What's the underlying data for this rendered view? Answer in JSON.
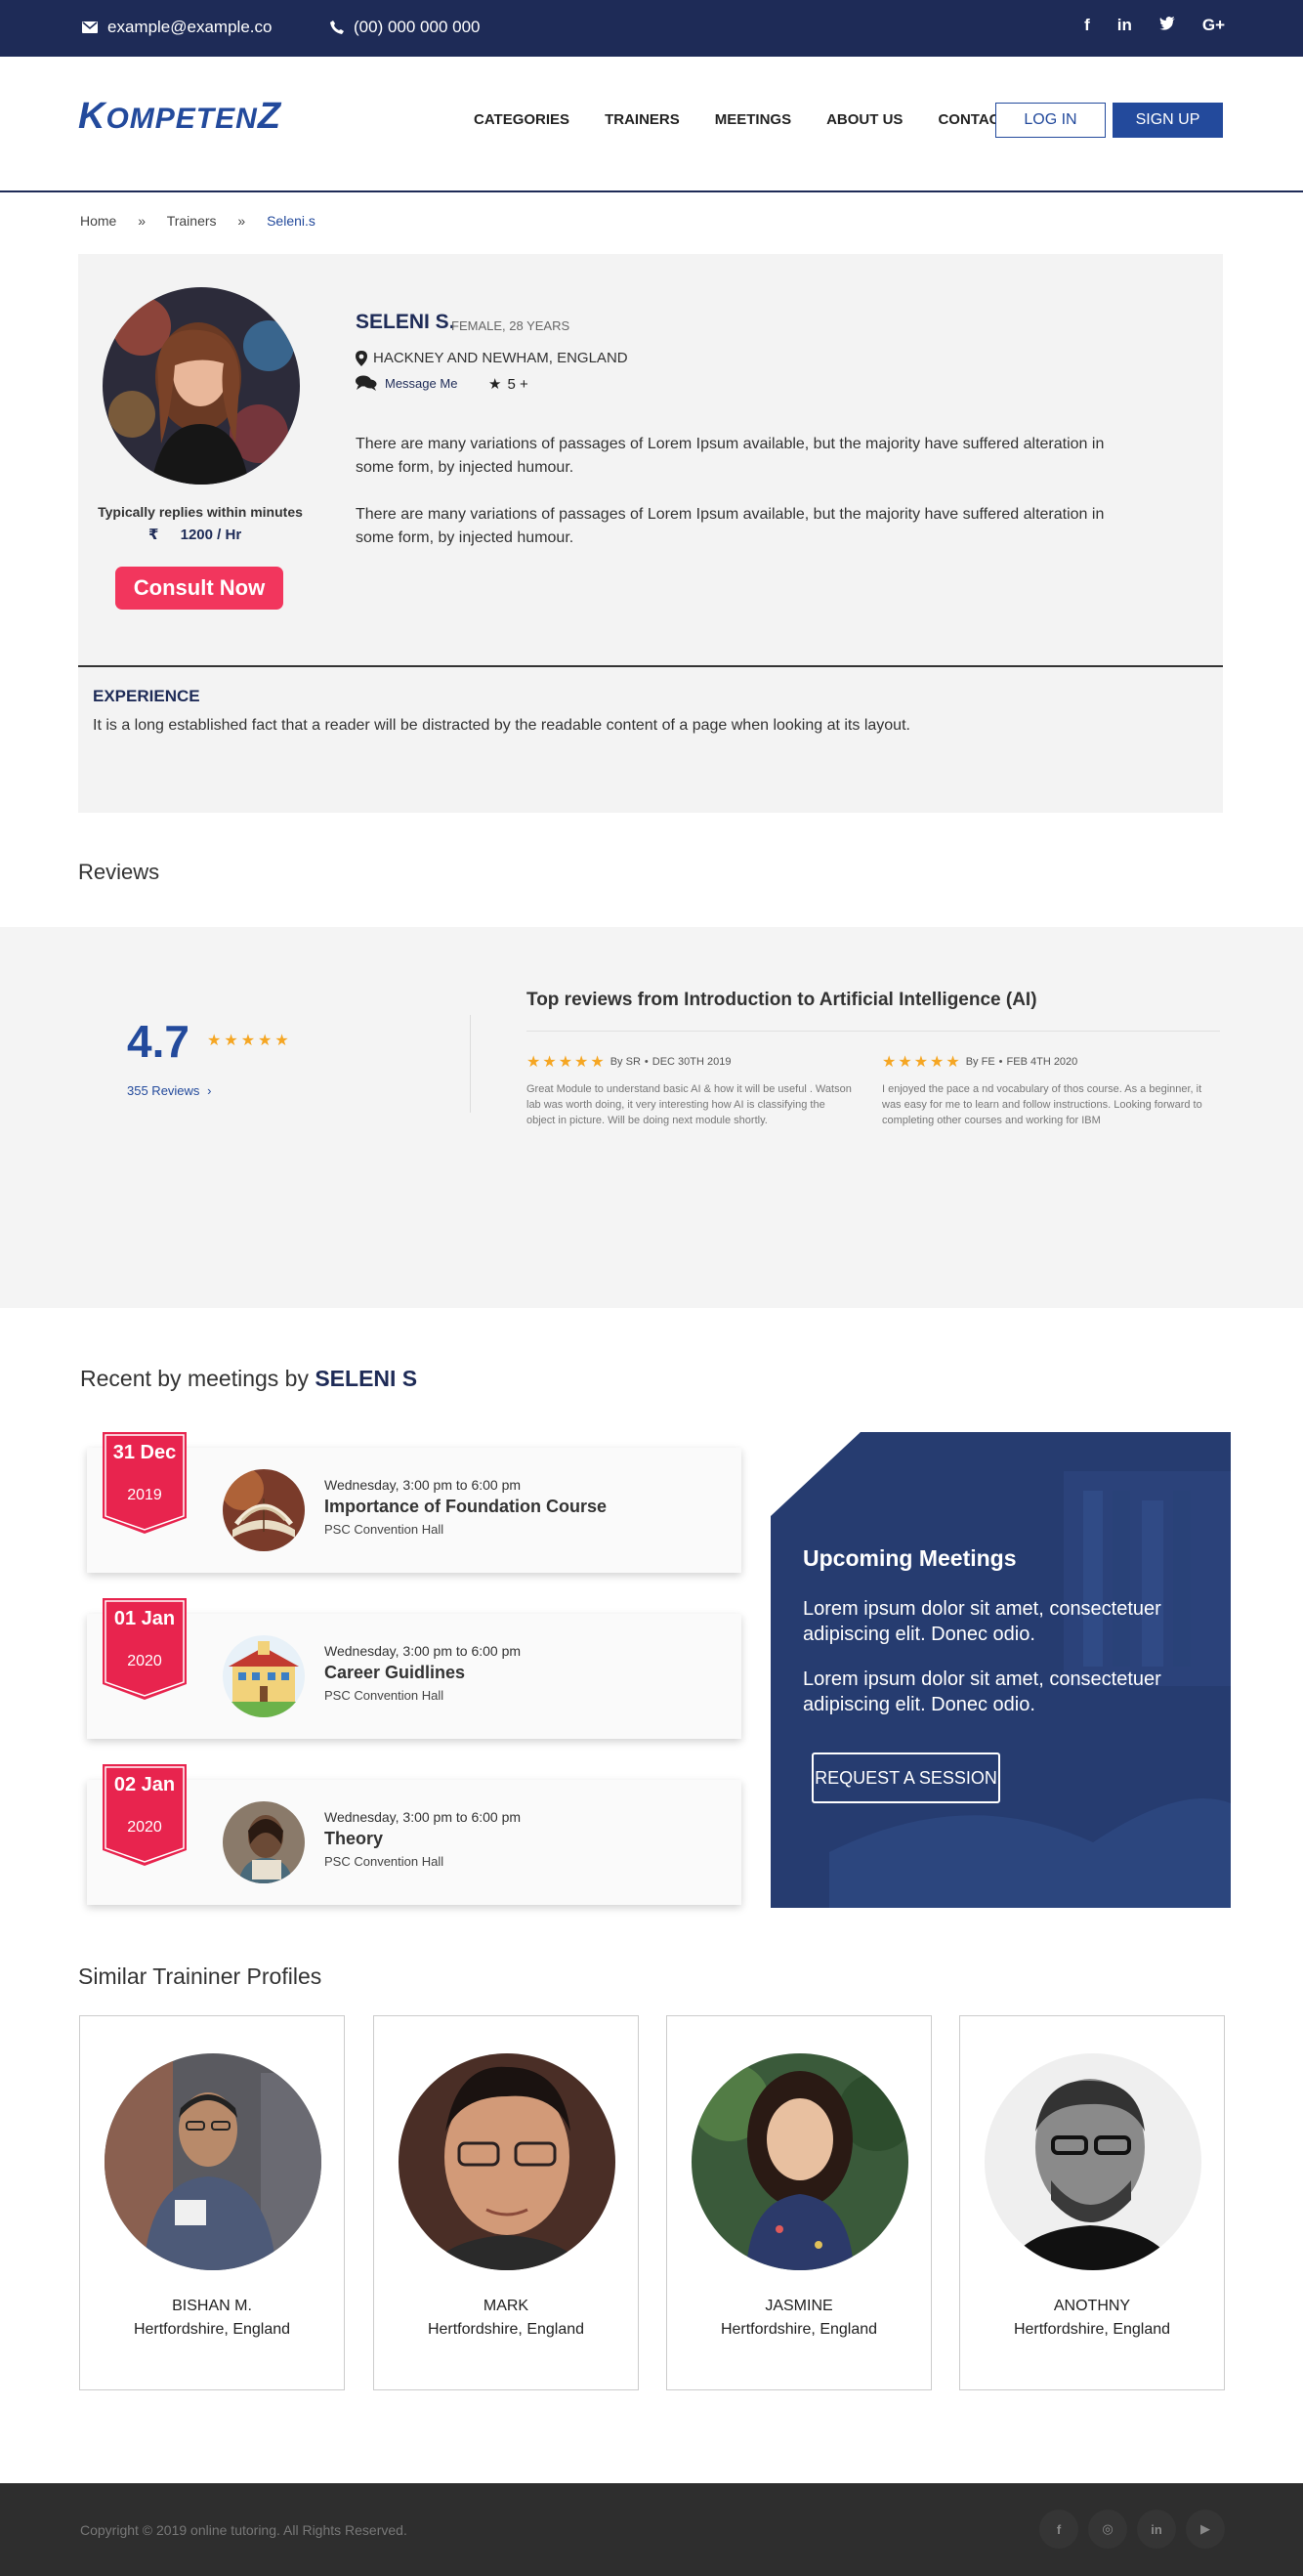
{
  "topbar": {
    "email": "example@example.co",
    "phone": "(00) 000 000 000",
    "social": [
      "f",
      "in",
      "t",
      "G+"
    ]
  },
  "header": {
    "logo_first": "K",
    "logo_rest": "OMPETEN",
    "logo_last": "Z",
    "nav": [
      "CATEGORIES",
      "TRAINERS",
      "MEETINGS",
      "ABOUT US",
      "CONTACT"
    ],
    "login": "LOG IN",
    "signup": "SIGN UP"
  },
  "breadcrumb": {
    "home": "Home",
    "trainers": "Trainers",
    "current": "Seleni.s",
    "sep": "»"
  },
  "profile": {
    "name": "SELENI S.",
    "meta": "FEMALE, 28 YEARS",
    "location": "HACKNEY AND NEWHAM, ENGLAND",
    "message": "Message Me",
    "rating": "5 +",
    "desc1": "There are many variations of passages of Lorem Ipsum available, but the majority have suffered alteration in some form, by injected humour.",
    "desc2": "There are many variations of passages of Lorem Ipsum available, but the majority have suffered alteration in some form, by injected humour.",
    "replies": "Typically replies within minutes",
    "currency": "₹",
    "rate": "1200 / Hr",
    "consult": "Consult Now",
    "experience_title": "EXPERIENCE",
    "experience_text": "It is a long established fact that a reader will be distracted by the readable content of a page when looking at its layout."
  },
  "reviews": {
    "title": "Reviews",
    "rating": "4.7",
    "stars": "★★★★★",
    "count": "355 Reviews",
    "top_title": "Top reviews from Introduction to Artificial Intelligence (AI)",
    "items": [
      {
        "stars": "★★★★★",
        "by": "By SR",
        "date": "DEC 30TH 2019",
        "text": "Great Module to understand basic AI & how it will be useful . Watson lab was worth doing, it very interesting how AI is classifying the object in picture. Will be doing next module shortly."
      },
      {
        "stars": "★★★★★",
        "by": "By FE",
        "date": "FEB 4TH 2020",
        "text": "I enjoyed the pace a nd vocabulary of thos course. As a beginner, it was easy for me to learn and follow instructions. Looking forward to completing other courses and working for IBM"
      }
    ]
  },
  "meetings": {
    "title_prefix": "Recent by meetings by",
    "title_name": "SELENI S",
    "items": [
      {
        "date": "31 Dec",
        "year": "2019",
        "time": "Wednesday, 3:00 pm to 6:00 pm",
        "name": "Importance of Foundation Course",
        "place": "PSC Convention Hall"
      },
      {
        "date": "01 Jan",
        "year": "2020",
        "time": "Wednesday, 3:00 pm to 6:00 pm",
        "name": "Career  Guidlines",
        "place": "PSC Convention Hall"
      },
      {
        "date": "02 Jan",
        "year": "2020",
        "time": "Wednesday, 3:00 pm to 6:00 pm",
        "name": "Theory",
        "place": "PSC Convention Hall"
      }
    ],
    "upcoming_title": "Upcoming Meetings",
    "upcoming_p1": "Lorem ipsum dolor sit amet, consectetuer adipiscing elit. Donec odio.",
    "upcoming_p2": "Lorem ipsum dolor sit amet, consectetuer adipiscing elit. Donec odio.",
    "request": "REQUEST  A  SESSION"
  },
  "similar": {
    "title": "Similar Traininer Profiles",
    "items": [
      {
        "name": "BISHAN M.",
        "location": "Hertfordshire, England"
      },
      {
        "name": "MARK",
        "location": "Hertfordshire, England"
      },
      {
        "name": "JASMINE",
        "location": "Hertfordshire, England"
      },
      {
        "name": "ANOTHNY",
        "location": "Hertfordshire, England"
      }
    ]
  },
  "footer": {
    "copyright": "Copyright © 2019 online tutoring. All Rights Reserved.",
    "social": [
      "f",
      "◎",
      "in",
      "▶"
    ]
  }
}
